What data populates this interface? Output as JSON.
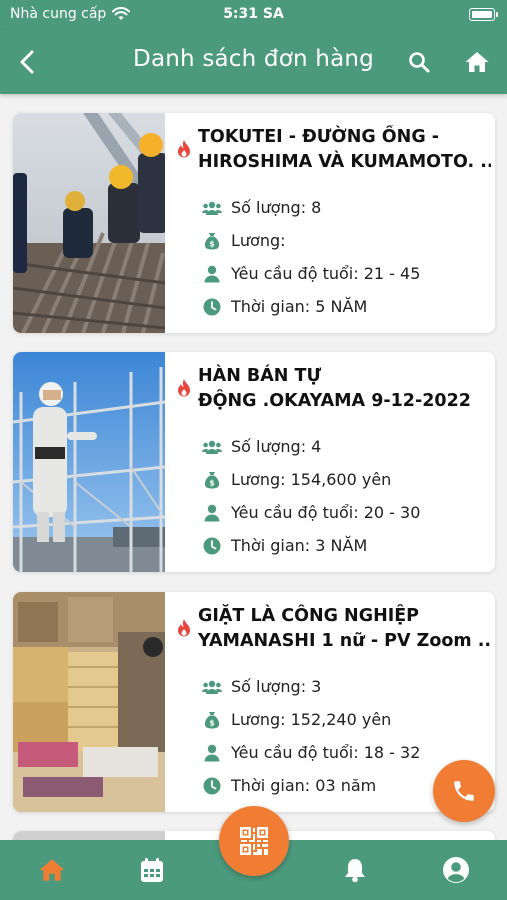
{
  "status_bar": {
    "carrier": "Nhà cung cấp",
    "time": "5:31 SA"
  },
  "header": {
    "title": "Danh sách đơn hàng"
  },
  "orders": [
    {
      "title_line1": "TOKUTEI - ĐƯỜNG ỐNG -",
      "title_line2": "HIROSHIMA VÀ KUMAMOTO. ...",
      "quantity": "Số lượng: 8",
      "salary": "Lương:",
      "age": "Yêu cầu độ tuổi: 21 - 45",
      "duration": "Thời gian: 5 NĂM"
    },
    {
      "title_line1": "HÀN BÁN TỰ",
      "title_line2": "ĐỘNG .OKAYAMA 9-12-2022",
      "quantity": "Số lượng: 4",
      "salary": "Lương: 154,600 yên",
      "age": "Yêu cầu độ tuổi: 20 - 30",
      "duration": "Thời gian: 3 NĂM"
    },
    {
      "title_line1": "GIẶT LÀ CÔNG NGHIỆP",
      "title_line2": "YAMANASHI 1 nữ - PV Zoom ...",
      "quantity": "Số lượng: 3",
      "salary": "Lương: 152,240 yên",
      "age": "Yêu cầu độ tuổi: 18 - 32",
      "duration": "Thời gian: 03 năm"
    }
  ],
  "icons": {
    "back": "chevron-left-icon",
    "search": "search-icon",
    "home": "home-icon",
    "fire": "fire-icon",
    "quantity": "users-icon",
    "salary": "money-bag-icon",
    "age": "user-icon",
    "duration": "clock-icon",
    "tab_home": "home-icon",
    "tab_calendar": "calendar-icon",
    "tab_qr": "qr-code-icon",
    "tab_bell": "bell-icon",
    "tab_profile": "profile-icon",
    "call": "phone-icon"
  },
  "colors": {
    "primary": "#4c9a7d",
    "accent": "#f07d33",
    "fire": "#e8453c",
    "text": "#111111",
    "background": "#f2f2f2"
  }
}
